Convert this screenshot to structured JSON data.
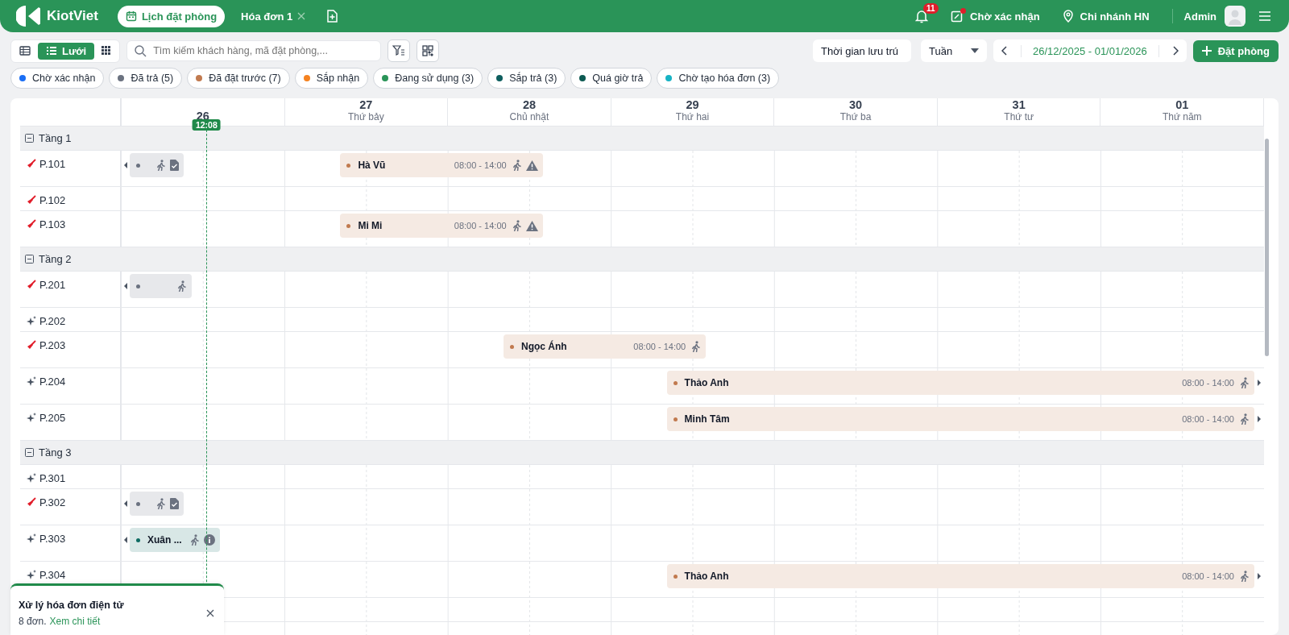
{
  "header": {
    "logo": "KiotViet",
    "tabs": [
      {
        "label": "Lịch đặt phòng",
        "selected": true,
        "closable": false
      },
      {
        "label": "Hóa đơn 1",
        "selected": false,
        "closable": true
      }
    ],
    "notification_count": "11",
    "pending": {
      "label": "Chờ xác nhận",
      "unread": true
    },
    "branch": "Chi nhánh HN",
    "user": "Admin"
  },
  "toolbar": {
    "views": [
      {
        "kind": "table",
        "selected": false
      },
      {
        "kind": "list",
        "label": "Lưới",
        "selected": true
      },
      {
        "kind": "grid",
        "selected": false
      }
    ],
    "search": {
      "placeholder": "Tìm kiếm khách hàng, mã đặt phòng,..."
    },
    "stay_filter": "Thời gian lưu trú",
    "period": "Tuần",
    "date_range": "26/12/2025 - 01/01/2026",
    "book_button": "Đặt phòng"
  },
  "statuses": [
    {
      "label": "Chờ xác nhận",
      "color": "#1a6ef5"
    },
    {
      "label": "Đã trả (5)",
      "color": "#6b7280"
    },
    {
      "label": "Đã đặt trước (7)",
      "color": "#c17a4f"
    },
    {
      "label": "Sắp nhận",
      "color": "#f58220"
    },
    {
      "label": "Đang sử dụng (3)",
      "color": "#2a9458"
    },
    {
      "label": "Sắp trả (3)",
      "color": "#0e5e5e"
    },
    {
      "label": "Quá giờ trả",
      "color": "#0d5a52"
    },
    {
      "label": "Chờ tạo hóa đơn (3)",
      "color": "#17b3c4"
    }
  ],
  "calendar": {
    "now": "12:08",
    "days": [
      {
        "date": "26"
      },
      {
        "date": "27",
        "weekday": "Thứ bảy"
      },
      {
        "date": "28",
        "weekday": "Chủ nhật"
      },
      {
        "date": "29",
        "weekday": "Thứ hai"
      },
      {
        "date": "30",
        "weekday": "Thứ ba"
      },
      {
        "date": "31",
        "weekday": "Thứ tư"
      },
      {
        "date": "01",
        "weekday": "Thứ năm"
      }
    ],
    "floors": [
      {
        "name": "Tầng 1",
        "expanded": true,
        "rooms": [
          {
            "name": "P.101",
            "dirty": true,
            "bookings": [
              {
                "color": "#6b7280",
                "continues_left": true,
                "continues_right": false,
                "paid": true,
                "warning": false,
                "note": false
              },
              {
                "guest": "Hà Vũ",
                "time": "08:00 - 14:00",
                "color": "#c17a4f",
                "continues_left": false,
                "continues_right": false,
                "paid": false,
                "warning": true,
                "note": false
              }
            ]
          },
          {
            "name": "P.102",
            "dirty": true
          },
          {
            "name": "P.103",
            "dirty": true,
            "bookings": [
              {
                "guest": "Mi Mi",
                "time": "08:00 - 14:00",
                "color": "#c17a4f",
                "continues_left": false,
                "continues_right": false,
                "paid": false,
                "warning": true,
                "note": false
              }
            ]
          }
        ]
      },
      {
        "name": "Tầng 2",
        "expanded": true,
        "rooms": [
          {
            "name": "P.201",
            "dirty": true,
            "bookings": [
              {
                "color": "#6b7280",
                "continues_left": true,
                "continues_right": false,
                "paid": false,
                "warning": false,
                "note": false
              }
            ]
          },
          {
            "name": "P.202",
            "dirty": false
          },
          {
            "name": "P.203",
            "dirty": true,
            "bookings": [
              {
                "guest": "Ngọc Ánh",
                "time": "08:00 - 14:00",
                "color": "#c17a4f",
                "continues_left": false,
                "continues_right": false,
                "paid": false,
                "warning": false,
                "note": false
              }
            ]
          },
          {
            "name": "P.204",
            "dirty": false,
            "bookings": [
              {
                "guest": "Thảo Anh",
                "time": "08:00 - 14:00",
                "color": "#c17a4f",
                "continues_left": false,
                "continues_right": true,
                "paid": false,
                "warning": false,
                "note": false
              }
            ]
          },
          {
            "name": "P.205",
            "dirty": false,
            "bookings": [
              {
                "guest": "Minh Tâm",
                "time": "08:00 - 14:00",
                "color": "#c17a4f",
                "continues_left": false,
                "continues_right": true,
                "paid": false,
                "warning": false,
                "note": false
              }
            ]
          }
        ]
      },
      {
        "name": "Tầng 3",
        "expanded": true,
        "rooms": [
          {
            "name": "P.301",
            "dirty": false
          },
          {
            "name": "P.302",
            "dirty": true,
            "bookings": [
              {
                "color": "#6b7280",
                "continues_left": true,
                "continues_right": false,
                "paid": true,
                "warning": false,
                "note": false
              }
            ]
          },
          {
            "name": "P.303",
            "dirty": false,
            "bookings": [
              {
                "guest": "Xuân ...",
                "color": "#0e6b62",
                "continues_left": true,
                "continues_right": false,
                "paid": false,
                "warning": false,
                "note": true
              }
            ]
          },
          {
            "name": "P.304",
            "dirty": false,
            "bookings": [
              {
                "guest": "Thảo Anh",
                "time": "08:00 - 14:00",
                "color": "#c17a4f",
                "continues_left": false,
                "continues_right": true,
                "paid": false,
                "warning": false,
                "note": false
              }
            ]
          }
        ]
      }
    ]
  },
  "toast": {
    "title": "Xử lý hóa đơn điện tử",
    "text": "8 đơn.",
    "link": "Xem chi tiết"
  }
}
